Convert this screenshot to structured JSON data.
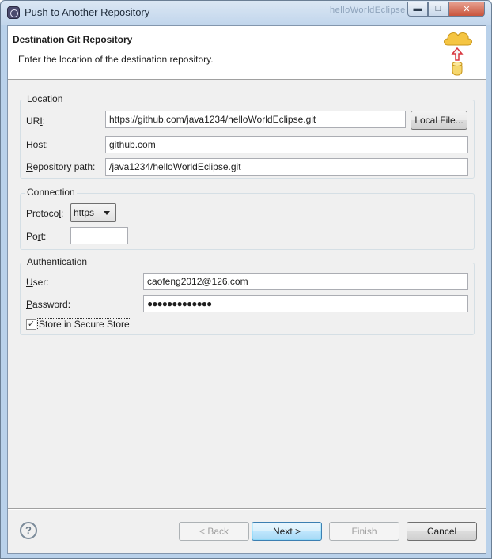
{
  "window": {
    "title": "Push to Another Repository",
    "background_title": "helloWorldEclipse"
  },
  "header": {
    "title": "Destination Git Repository",
    "description": "Enter the location of the destination repository."
  },
  "location": {
    "group_label": "Location",
    "uri_label": "URI:",
    "uri_value": "https://github.com/java1234/helloWorldEclipse.git",
    "local_file_button": "Local File...",
    "host_label": "Host:",
    "host_value": "github.com",
    "repo_path_label": "Repository path:",
    "repo_path_value": "/java1234/helloWorldEclipse.git"
  },
  "connection": {
    "group_label": "Connection",
    "protocol_label": "Protocol:",
    "protocol_value": "https",
    "port_label": "Port:",
    "port_value": ""
  },
  "authentication": {
    "group_label": "Authentication",
    "user_label": "User:",
    "user_value": "caofeng2012@126.com",
    "password_label": "Password:",
    "password_value": "●●●●●●●●●●●●●",
    "store_label": "Store in Secure Store",
    "store_checked": true
  },
  "buttons": {
    "back": "< Back",
    "next": "Next >",
    "finish": "Finish",
    "cancel": "Cancel"
  },
  "icons": {
    "app": "eclipse-icon",
    "wizard": "cloud-push-icon",
    "help": "help-icon"
  }
}
